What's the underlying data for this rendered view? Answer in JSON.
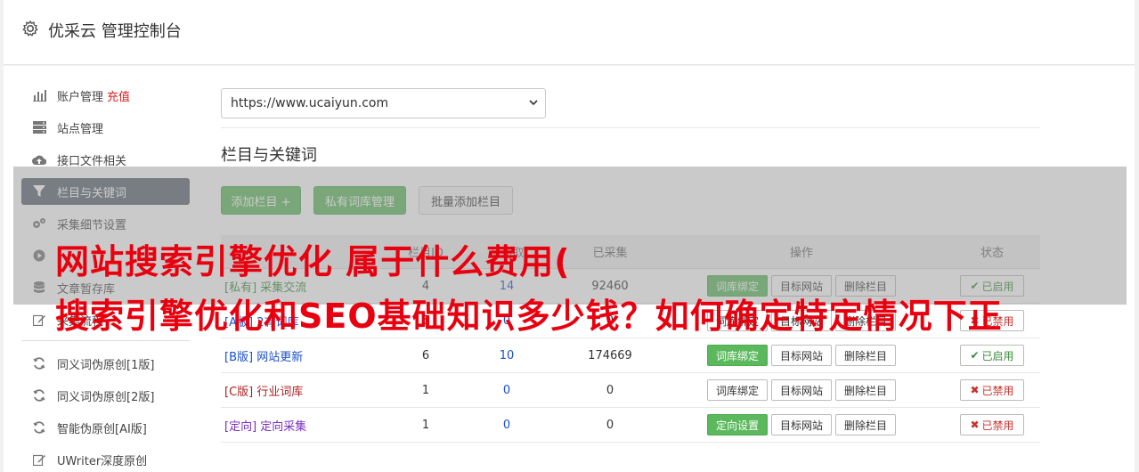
{
  "header": {
    "title": "优采云 管理控制台",
    "icon": "gear-icon"
  },
  "sidebar": {
    "items": [
      {
        "label": "账户管理",
        "badge": "充值",
        "icon": "bar-chart-icon"
      },
      {
        "label": "站点管理",
        "icon": "server-icon"
      },
      {
        "label": "接口文件相关",
        "icon": "cloud-upload-icon"
      },
      {
        "label": "栏目与关键词",
        "icon": "filter-icon",
        "active": true
      },
      {
        "label": "采集细节设置",
        "icon": "gears-icon"
      },
      {
        "label": "",
        "icon": "play-circle-icon"
      },
      {
        "label": "文章暂存库",
        "icon": "database-icon"
      },
      {
        "label": "采集流程",
        "icon": "edit-icon"
      }
    ],
    "items2": [
      {
        "label": "同义词伪原创[1版]",
        "icon": "refresh-icon"
      },
      {
        "label": "同义词伪原创[2版]",
        "icon": "refresh-icon"
      },
      {
        "label": "智能伪原创[AI版]",
        "icon": "refresh-icon"
      },
      {
        "label": "UWriter深度原创",
        "icon": "edit-icon"
      }
    ]
  },
  "site_select": {
    "value": "https://www.ucaiyun.com"
  },
  "section": {
    "title": "栏目与关键词",
    "buttons": {
      "add": "添加栏目 +",
      "private_lib": "私有词库管理",
      "batch_add": "批量添加栏目"
    }
  },
  "table": {
    "headers": [
      "栏目ID",
      "待抓取",
      "已采集",
      "操作",
      "状态"
    ],
    "rows": [
      {
        "tag": "[私有]",
        "name": "采集交流",
        "id": "4",
        "pending": "14",
        "collected": "92460",
        "op1": "词库绑定",
        "op1_green": true,
        "op2": "目标网站",
        "op3": "删除栏目",
        "status": "已启用",
        "on": true,
        "tagclass": "tag-priv"
      },
      {
        "tag": "[A版]",
        "name": "2有词库",
        "id": "5",
        "pending": "0",
        "collected": "0",
        "op1": "词库绑定",
        "op1_green": false,
        "op2": "目标网站",
        "op3": "删除栏目",
        "status": "已禁用",
        "on": false,
        "tagclass": "tag-b"
      },
      {
        "tag": "[B版]",
        "name": "网站更新",
        "id": "6",
        "pending": "10",
        "collected": "174669",
        "op1": "词库绑定",
        "op1_green": true,
        "op2": "目标网站",
        "op3": "删除栏目",
        "status": "已启用",
        "on": true,
        "tagclass": "tag-b"
      },
      {
        "tag": "[C版]",
        "name": "行业词库",
        "id": "1",
        "pending": "0",
        "collected": "0",
        "op1": "词库绑定",
        "op1_green": false,
        "op2": "目标网站",
        "op3": "删除栏目",
        "status": "已禁用",
        "on": false,
        "tagclass": "tag-c"
      },
      {
        "tag": "[定向]",
        "name": "定向采集",
        "id": "1",
        "pending": "0",
        "collected": "0",
        "op1": "定向设置",
        "op1_green": true,
        "op2": "目标网站",
        "op3": "删除栏目",
        "status": "已禁用",
        "on": false,
        "tagclass": "tag-dir"
      }
    ]
  },
  "overlay": {
    "line1": "网站搜索引擎优化 属于什么费用(",
    "line2": "搜索引擎优化和SEO基础知识多少钱？如何确定特定情况下正"
  }
}
